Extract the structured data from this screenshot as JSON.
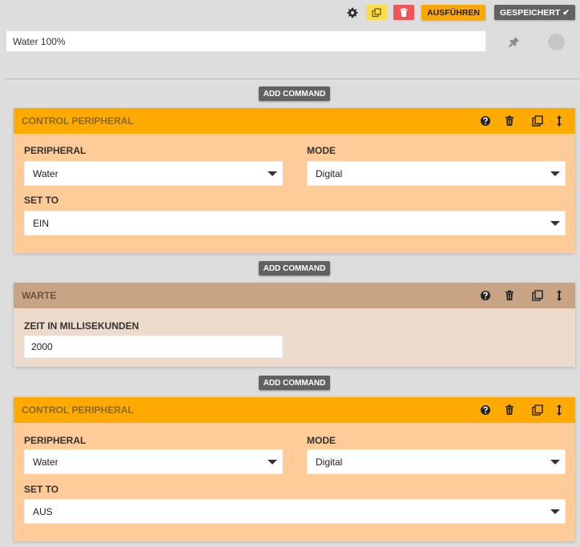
{
  "toolbar": {
    "run_label": "AUSFÜHREN",
    "saved_label": "GESPEICHERT ✔",
    "colors": {
      "copy": "#fddb4a",
      "delete": "#f0555a",
      "run": "#ffa600",
      "saved": "#626262"
    }
  },
  "sequence_name": {
    "value": "Water 100%"
  },
  "add_command_label": "ADD COMMAND",
  "commands": [
    {
      "title": "CONTROL PERIPHERAL",
      "peripheral_label": "PERIPHERAL",
      "peripheral_value": "Water",
      "mode_label": "MODE",
      "mode_value": "Digital",
      "set_to_label": "SET TO",
      "set_to_value": "EIN"
    },
    {
      "title": "WARTE",
      "time_label": "ZEIT IN MILLISEKUNDEN",
      "time_value": "2000"
    },
    {
      "title": "CONTROL PERIPHERAL",
      "peripheral_label": "PERIPHERAL",
      "peripheral_value": "Water",
      "mode_label": "MODE",
      "mode_value": "Digital",
      "set_to_label": "SET TO",
      "set_to_value": "AUS"
    }
  ],
  "icons": [
    "gear-icon",
    "copy-icon",
    "trash-icon",
    "pin-icon",
    "help-icon",
    "duplicate-icon",
    "move-icon"
  ]
}
